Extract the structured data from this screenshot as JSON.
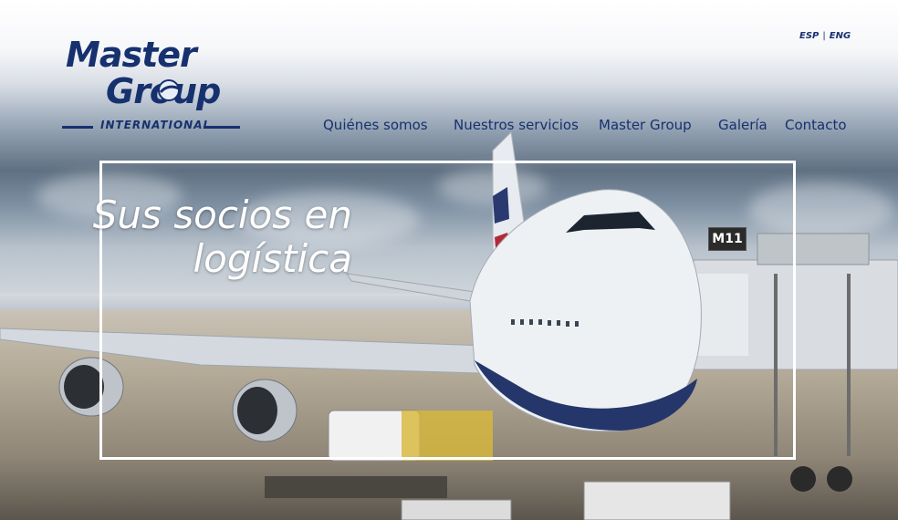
{
  "brand": {
    "word1": "Master",
    "word2": "Group",
    "tagline": "INTERNATIONAL",
    "color": "#17316f"
  },
  "language": {
    "esp": "ESP",
    "separator": "|",
    "eng": "ENG"
  },
  "nav": {
    "items": [
      {
        "label": "Quiénes somos"
      },
      {
        "label": "Nuestros servicios"
      },
      {
        "label": "Master Group"
      },
      {
        "label": "Galería"
      },
      {
        "label": "Contacto"
      }
    ]
  },
  "hero": {
    "title_line1": "Sus socios en",
    "title_line2": "logística",
    "gate_sign": "M11"
  },
  "colors": {
    "primary": "#17316f",
    "frame": "#ffffff"
  }
}
